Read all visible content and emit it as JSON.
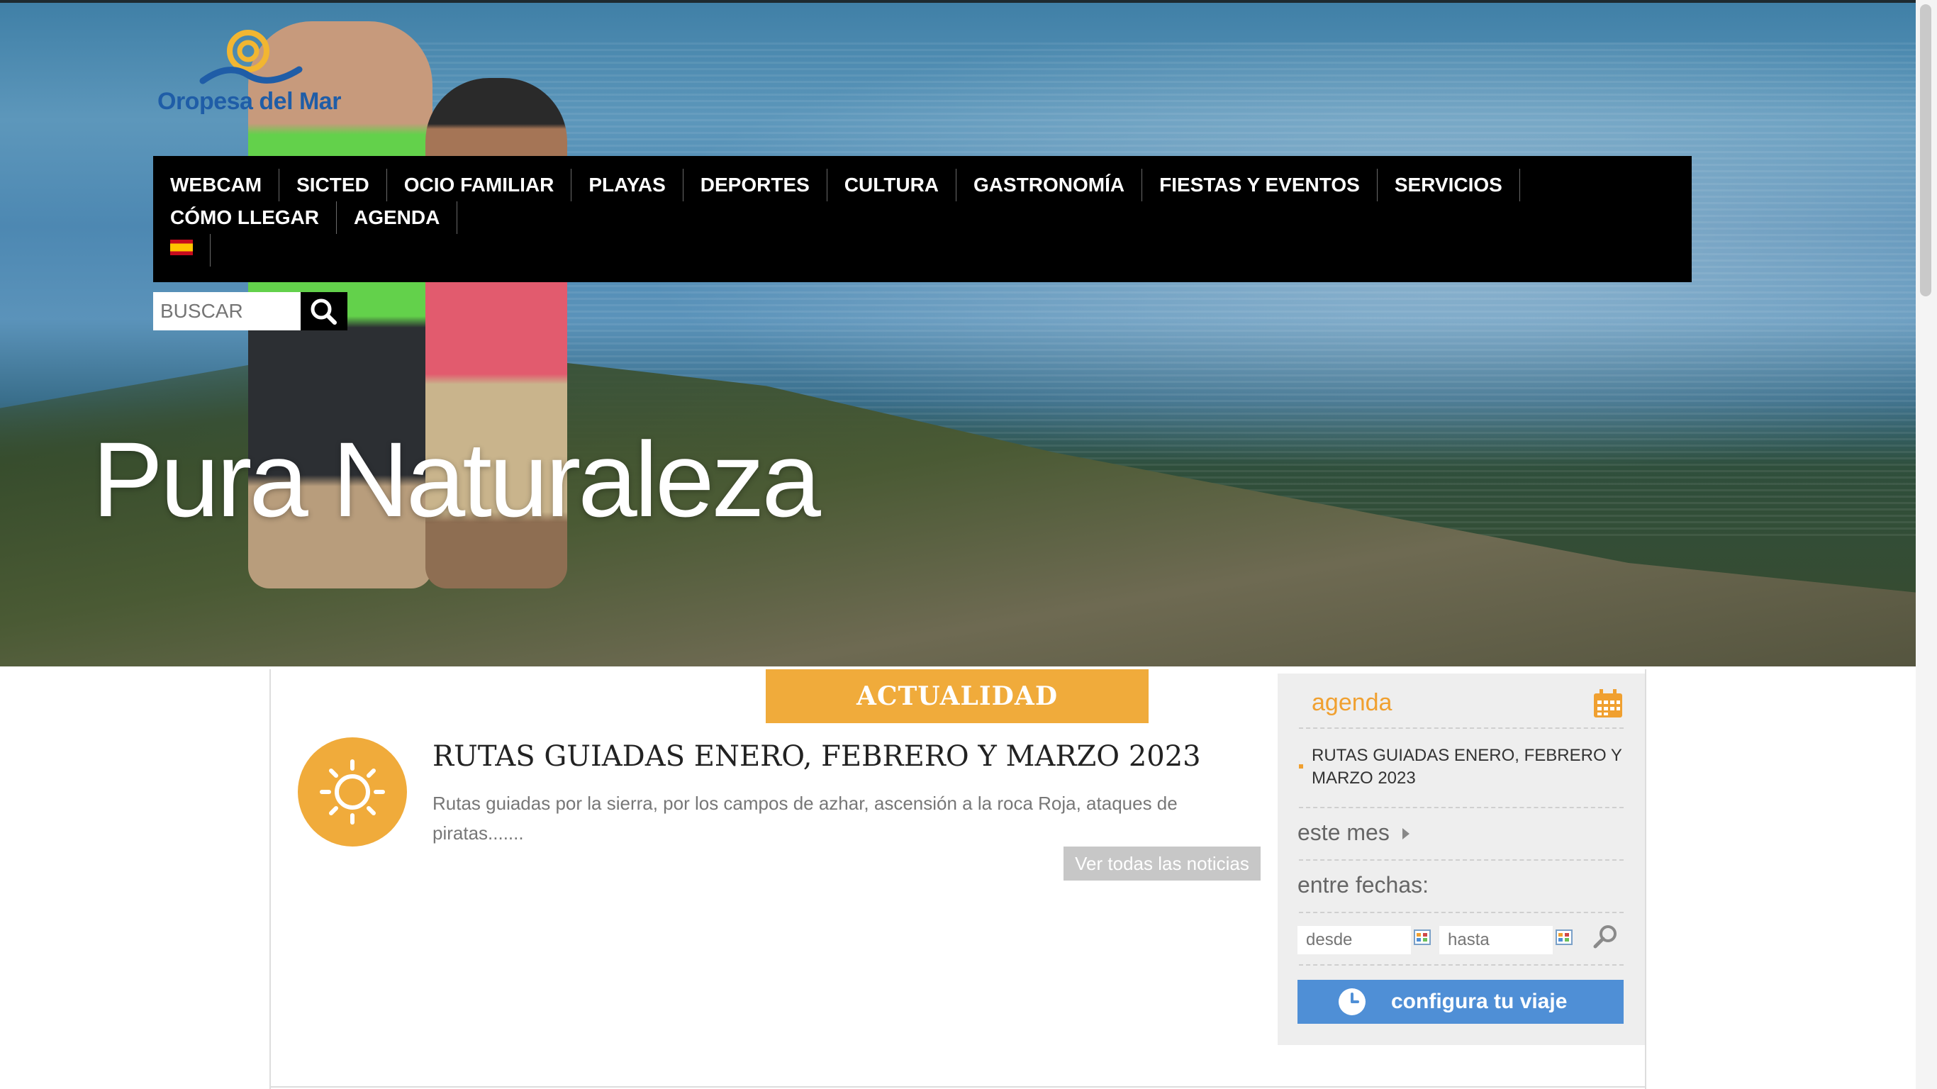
{
  "brand": {
    "logo_text": "Oropesa del Mar"
  },
  "hero": {
    "title": "Pura Naturaleza"
  },
  "nav": {
    "items": [
      "WEBCAM",
      "SICTED",
      "OCIO FAMILIAR",
      "PLAYAS",
      "DEPORTES",
      "CULTURA",
      "GASTRONOMÍA",
      "FIESTAS Y EVENTOS",
      "SERVICIOS",
      "CÓMO LLEGAR",
      "AGENDA"
    ],
    "language_flag": "spain-flag-icon"
  },
  "search": {
    "placeholder": "BUSCAR"
  },
  "news": {
    "section_label": "ACTUALIDAD",
    "title": "RUTAS GUIADAS ENERO, FEBRERO Y MARZO 2023",
    "description": "Rutas guiadas por la sierra, por los campos de azhar, ascensión a la roca Roja, ataques de piratas.......",
    "see_all": "Ver todas las noticias",
    "icon": "sun-icon"
  },
  "agenda": {
    "title": "agenda",
    "event": "RUTAS GUIADAS ENERO, FEBRERO Y MARZO 2023",
    "this_month": "este mes",
    "between_dates": "entre fechas:",
    "from_placeholder": "desde",
    "to_placeholder": "hasta",
    "cta": "configura tu viaje"
  },
  "colors": {
    "accent": "#f0ab3b",
    "cta": "#4f8fd6",
    "nav": "#000000"
  }
}
